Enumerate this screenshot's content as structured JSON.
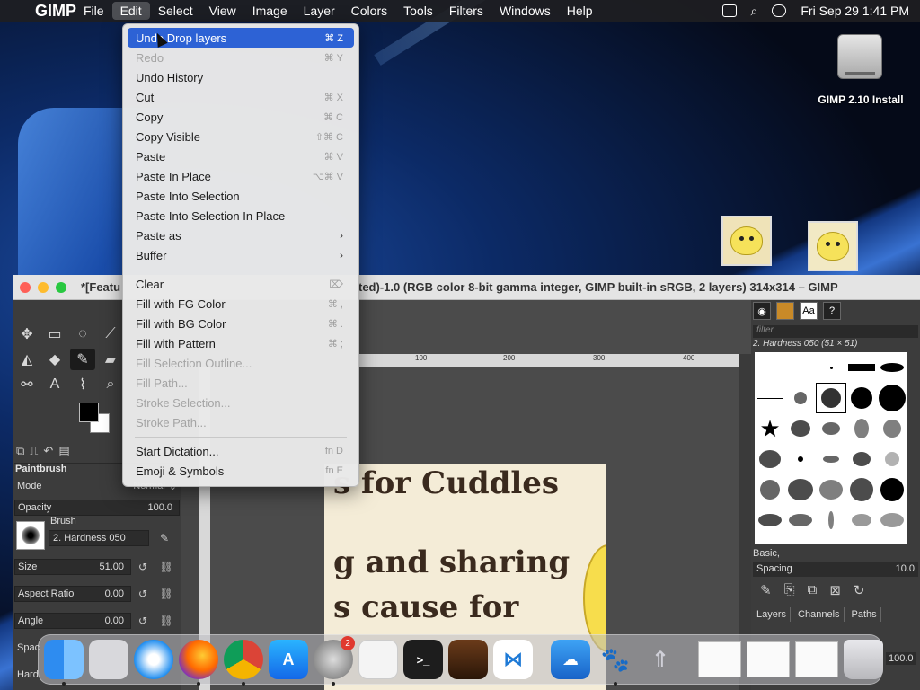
{
  "menubar": {
    "app_name": "GIMP",
    "items": [
      "File",
      "Edit",
      "Select",
      "View",
      "Image",
      "Layer",
      "Colors",
      "Tools",
      "Filters",
      "Windows",
      "Help"
    ],
    "clock": "Fri Sep 29  1:41 PM"
  },
  "desktop": {
    "disk_label": "GIMP 2.10 Install"
  },
  "window": {
    "title_left": "*[Featu",
    "title_right": "ted)-1.0 (RGB color 8-bit gamma integer, GIMP built-in sRGB, 2 layers) 314x314 – GIMP"
  },
  "edit_menu": {
    "items": [
      {
        "label": "Undo Drop layers",
        "shortcut": "⌘ Z",
        "state": "highlighted"
      },
      {
        "label": "Redo",
        "shortcut": "⌘ Y",
        "state": "disabled"
      },
      {
        "label": "Undo History",
        "shortcut": "",
        "state": "enabled"
      },
      {
        "label": "Cut",
        "shortcut": "⌘ X",
        "state": "enabled"
      },
      {
        "label": "Copy",
        "shortcut": "⌘ C",
        "state": "enabled"
      },
      {
        "label": "Copy Visible",
        "shortcut": "⇧⌘ C",
        "state": "enabled"
      },
      {
        "label": "Paste",
        "shortcut": "⌘ V",
        "state": "enabled"
      },
      {
        "label": "Paste In Place",
        "shortcut": "⌥⌘ V",
        "state": "enabled"
      },
      {
        "label": "Paste Into Selection",
        "shortcut": "",
        "state": "enabled"
      },
      {
        "label": "Paste Into Selection In Place",
        "shortcut": "",
        "state": "enabled"
      },
      {
        "label": "Paste as",
        "shortcut": "",
        "state": "submenu"
      },
      {
        "label": "Buffer",
        "shortcut": "",
        "state": "submenu"
      },
      {
        "label": "Clear",
        "shortcut": "⌦",
        "state": "enabled"
      },
      {
        "label": "Fill with FG Color",
        "shortcut": "⌘ ,",
        "state": "enabled"
      },
      {
        "label": "Fill with BG Color",
        "shortcut": "⌘ .",
        "state": "enabled"
      },
      {
        "label": "Fill with Pattern",
        "shortcut": "⌘ ;",
        "state": "enabled"
      },
      {
        "label": "Fill Selection Outline...",
        "shortcut": "",
        "state": "disabled"
      },
      {
        "label": "Fill Path...",
        "shortcut": "",
        "state": "disabled"
      },
      {
        "label": "Stroke Selection...",
        "shortcut": "",
        "state": "disabled"
      },
      {
        "label": "Stroke Path...",
        "shortcut": "",
        "state": "disabled"
      },
      {
        "label": "Start Dictation...",
        "shortcut": "fn D",
        "state": "enabled"
      },
      {
        "label": "Emoji & Symbols",
        "shortcut": "fn E",
        "state": "enabled"
      }
    ]
  },
  "toolbox": {
    "options_title": "Paintbrush",
    "mode_label": "Mode",
    "mode_value": "Normal",
    "opacity_label": "Opacity",
    "opacity_value": "100.0",
    "brush_label": "Brush",
    "brush_name": "2. Hardness 050",
    "size_label": "Size",
    "size_value": "51.00",
    "aspect_label": "Aspect Ratio",
    "aspect_value": "0.00",
    "angle_label": "Angle",
    "angle_value": "0.00",
    "spacing_label": "Spac",
    "hardness_label": "Hard"
  },
  "canvas": {
    "ruler_ticks": [
      "100",
      "200",
      "300",
      "400"
    ],
    "lines": [
      "s for Cuddles",
      "g and sharing",
      "s cause for"
    ]
  },
  "right_dock": {
    "filter_placeholder": "filter",
    "brush_name": "2. Hardness 050 (51 × 51)",
    "preset": "Basic,",
    "spacing_label": "Spacing",
    "spacing_value": "10.0",
    "tabs": [
      "Layers",
      "Channels",
      "Paths"
    ],
    "value": "100.0"
  },
  "dock": {
    "apps": [
      "finder",
      "launchpad",
      "safari",
      "firefox",
      "chrome",
      "app-store",
      "system-settings",
      "textedit",
      "terminal",
      "instruments",
      "vscode",
      "weather",
      "gimp",
      "rocket"
    ],
    "settings_badge": "2"
  },
  "colors": {
    "highlight": "#2d62d5",
    "menu_bg": "#e9e9e9",
    "gimp_bg": "#454545"
  }
}
